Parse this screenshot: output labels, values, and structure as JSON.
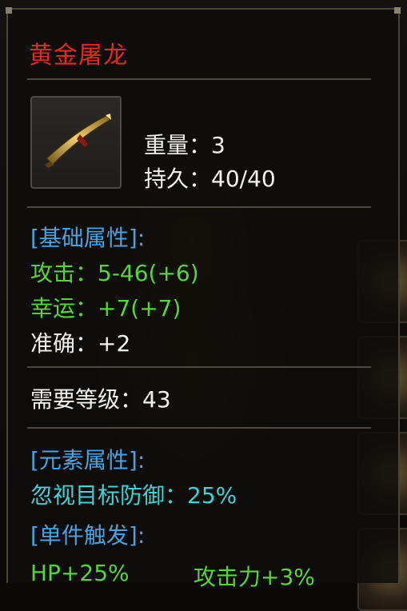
{
  "item": {
    "name": "黄金屠龙",
    "icon": "golden-sword-icon",
    "weight_label": "重量：3",
    "durability_label": "持久：40/40"
  },
  "basic": {
    "header": "[基础属性]:",
    "attack": "攻击：5-46(+6)",
    "luck": "幸运：+7(+7)",
    "accuracy": "准确：+2"
  },
  "requirement": "需要等级：43",
  "element": {
    "header": "[元素属性]:",
    "ignore_defense": "忽视目标防御：25%"
  },
  "trigger": {
    "header": "[单件触发]:",
    "hp": "HP+25%",
    "attack_power": "攻击力+3%"
  },
  "colors": {
    "name": "#e22a20",
    "header": "#4aa3e0",
    "green": "#58d638",
    "cyan": "#3fd2d6"
  }
}
